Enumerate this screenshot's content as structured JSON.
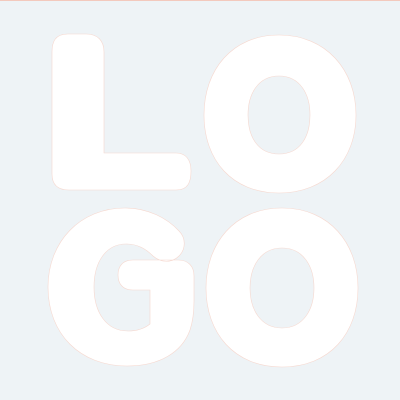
{
  "logo": {
    "text": "LOGO",
    "letters": [
      "L",
      "O",
      "G",
      "O"
    ]
  },
  "colors": {
    "background": "#eef3f6",
    "letter_fill": "#ffffff",
    "letter_outline": "#f6d8cf",
    "top_line": "#f3c9bd"
  }
}
